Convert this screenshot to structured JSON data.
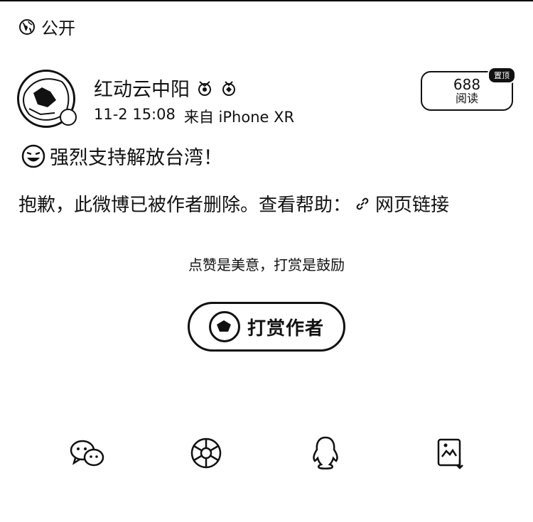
{
  "visibility": {
    "label": "公开",
    "icon": "globe-icon"
  },
  "author": {
    "name": "红动云中阳",
    "time": "11-2 15:08",
    "source": "来自 iPhone XR",
    "medals": [
      "medal-icon",
      "medal-icon"
    ]
  },
  "reads": {
    "count": "688",
    "label": "阅读",
    "badge": "置顶"
  },
  "post": {
    "emoji": "laughing-emoji",
    "text": "强烈支持解放台湾！"
  },
  "deleted_notice": {
    "text": "抱歉，此微博已被作者删除。查看帮助：",
    "link_label": "网页链接"
  },
  "reward": {
    "caption": "点赞是美意，打赏是鼓励",
    "button_label": "打赏作者"
  },
  "share": [
    {
      "icon": "wechat-icon"
    },
    {
      "icon": "moments-icon"
    },
    {
      "icon": "qq-icon"
    },
    {
      "icon": "save-image-icon"
    }
  ]
}
